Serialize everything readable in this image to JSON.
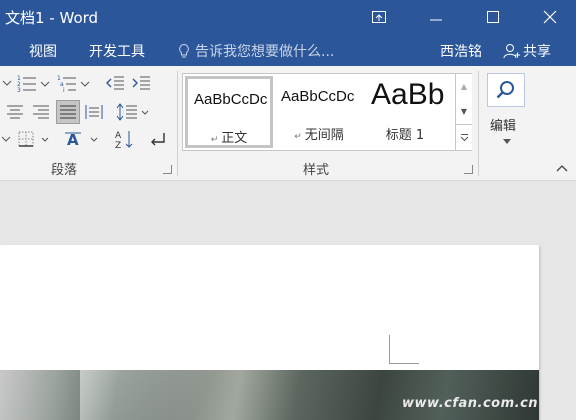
{
  "app": {
    "title": "文档1 - Word"
  },
  "window_controls": {
    "ribbon_options": "ribbon-display-options-icon",
    "minimize": "minimize-icon",
    "maximize": "maximize-icon",
    "close": "close-icon"
  },
  "menu": {
    "tabs": [
      {
        "label": "视图"
      },
      {
        "label": "开发工具"
      }
    ],
    "tell_me": "告诉我您想要做什么...",
    "user": "西浩铭",
    "share": "共享"
  },
  "ribbon": {
    "paragraph": {
      "label": "段落"
    },
    "styles": {
      "label": "样式",
      "items": [
        {
          "preview": "AaBbCcDc",
          "name": "正文",
          "selected": true
        },
        {
          "preview": "AaBbCcDc",
          "name": "无间隔",
          "selected": false
        },
        {
          "preview": "AaBb",
          "name": "标题 1",
          "selected": false
        }
      ]
    },
    "editing": {
      "label": "编辑"
    }
  },
  "colors": {
    "accent": "#2b579a",
    "ribbon_bg": "#f3f3f3",
    "doc_bg": "#e6e6e6"
  },
  "watermark": "www.cfan.com.cn"
}
